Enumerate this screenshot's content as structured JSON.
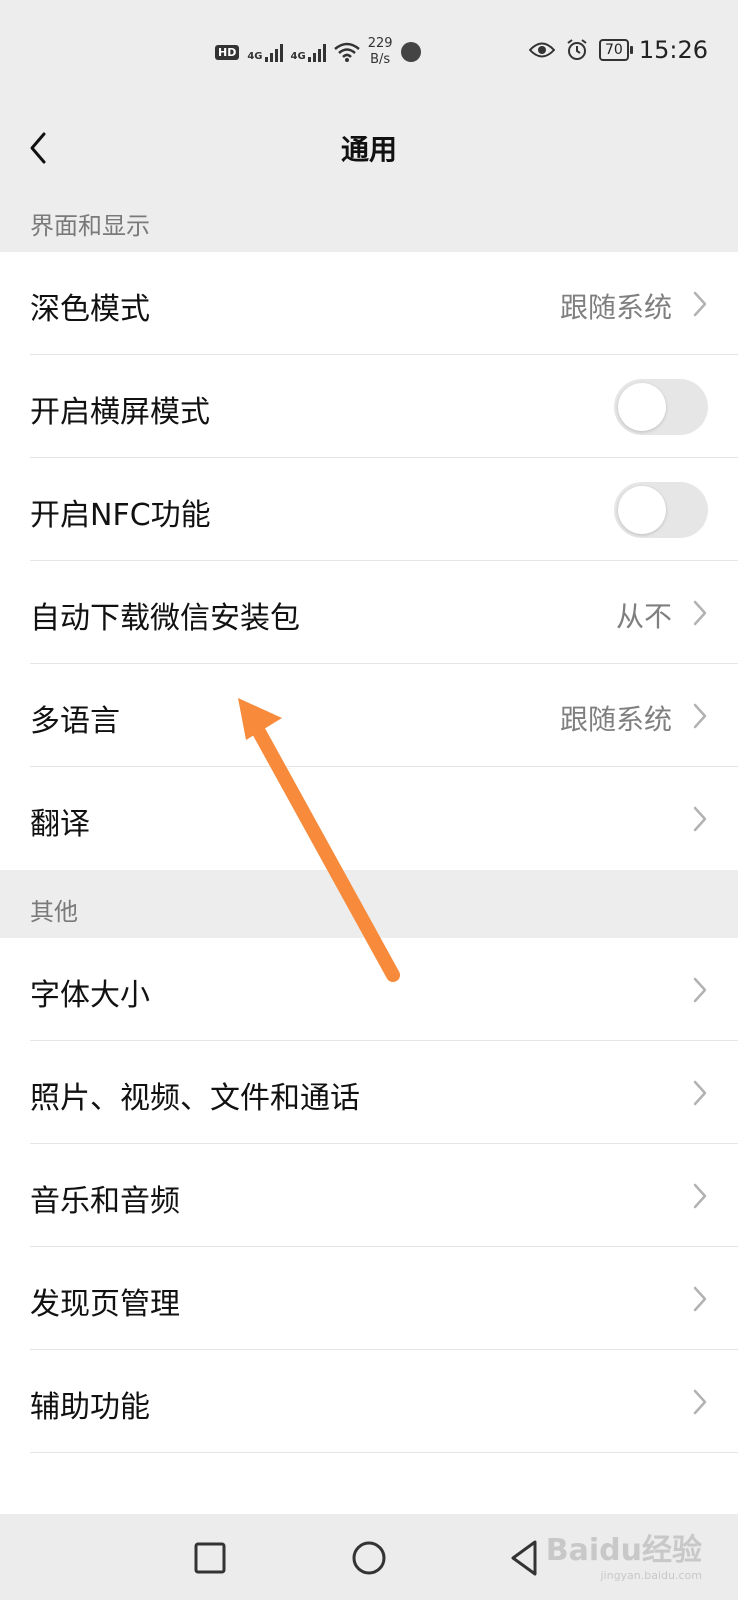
{
  "status_bar": {
    "hd": "HD",
    "net1": "4G",
    "net2": "4G",
    "speed_value": "229",
    "speed_unit": "B/s",
    "battery": "70",
    "time": "15:26"
  },
  "nav": {
    "title": "通用",
    "back_icon": "chevron-left-icon"
  },
  "sections": {
    "display": {
      "label": "界面和显示",
      "items": [
        {
          "label": "深色模式",
          "value": "跟随系统"
        },
        {
          "label": "开启横屏模式",
          "toggle": false
        },
        {
          "label": "开启NFC功能",
          "toggle": false
        },
        {
          "label": "自动下载微信安装包",
          "value": "从不"
        },
        {
          "label": "多语言",
          "value": "跟随系统"
        },
        {
          "label": "翻译"
        }
      ]
    },
    "other": {
      "label": "其他",
      "items": [
        {
          "label": "字体大小"
        },
        {
          "label": "照片、视频、文件和通话"
        },
        {
          "label": "音乐和音频"
        },
        {
          "label": "发现页管理"
        },
        {
          "label": "辅助功能"
        }
      ]
    }
  },
  "annotation": {
    "color": "#f78b3b"
  },
  "watermark": {
    "text": "Baidu经验",
    "sub": "jingyan.baidu.com"
  },
  "colors": {
    "background": "#ededed",
    "card": "#ffffff",
    "secondary_text": "#7f7f7f"
  }
}
